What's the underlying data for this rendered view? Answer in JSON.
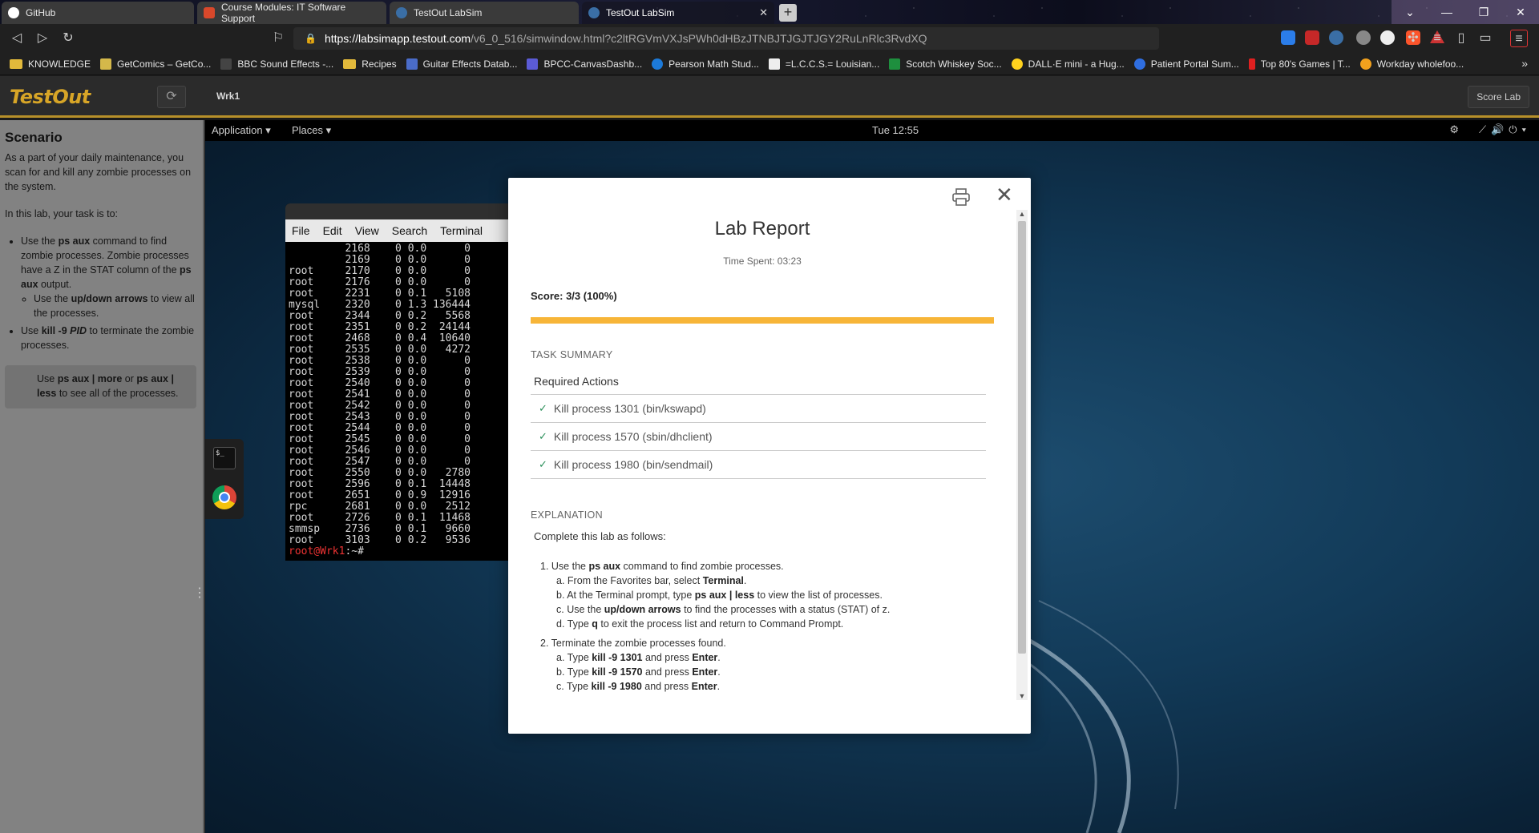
{
  "browser": {
    "tabs": [
      {
        "label": "GitHub",
        "favicon_color": "#ffffff"
      },
      {
        "label": "Course Modules: IT Software Support",
        "favicon_color": "#d9482b"
      },
      {
        "label": "TestOut LabSim",
        "favicon_color": "#3a6ea5"
      },
      {
        "label": "TestOut LabSim",
        "favicon_color": "#3a6ea5"
      }
    ],
    "active_tab_index": 3,
    "url_host": "https://labsimapp.testout.com",
    "url_rest": "/v6_0_516/simwindow.html?c2ltRGVmVXJsPWh0dHBzJTNBJTJGJTJGY2RuLnRlc3RvdXQuY29tJTJGX3ZlcnNpb25fNzAyOCUyRnB...",
    "bookmarks": [
      {
        "label": "KNOWLEDGE",
        "icon": "folder",
        "color": "#e2b93b"
      },
      {
        "label": "GetComics – GetCo...",
        "icon": "getcomics-icon",
        "color": "#d4b84a"
      },
      {
        "label": "BBC Sound Effects -...",
        "icon": "bbc-icon",
        "color": "#ffffff"
      },
      {
        "label": "Recipes",
        "icon": "folder",
        "color": "#e2b93b"
      },
      {
        "label": "Guitar Effects Datab...",
        "icon": "guitar-icon",
        "color": "#4a6cc9"
      },
      {
        "label": "BPCC-CanvasDashb...",
        "icon": "canvas-icon",
        "color": "#5b5bd6"
      },
      {
        "label": "Pearson Math Stud...",
        "icon": "pearson-icon",
        "color": "#1c7ad9"
      },
      {
        "label": "=L.C.C.S.= Louisian...",
        "icon": "lccs-icon",
        "color": "#eeeeee"
      },
      {
        "label": "Scotch Whiskey Soc...",
        "icon": "whiskey-icon",
        "color": "#1e8f3e"
      },
      {
        "label": "DALL·E mini - a Hug...",
        "icon": "huggingface-icon",
        "color": "#ffd21e"
      },
      {
        "label": "Patient Portal Sum...",
        "icon": "portal-icon",
        "color": "#2f6ee0"
      },
      {
        "label": "Top 80's Games | T...",
        "icon": "games-icon",
        "color": "#e02020"
      },
      {
        "label": "Workday wholefoo...",
        "icon": "workday-icon",
        "color": "#f2a11d"
      }
    ],
    "bookmarks_more": "»"
  },
  "testout": {
    "logo": "TestOut",
    "workstation": "Wrk1",
    "score_button": "Score Lab",
    "accent": "#d7a527"
  },
  "scenario": {
    "title": "Scenario",
    "intro": "As a part of your daily maintenance, you scan for and kill any zombie processes on the system.",
    "task_intro": "In this lab, your task is to:",
    "item1_a": "Use the ",
    "item1_cmd": "ps aux",
    "item1_b": " command to find zombie processes. Zombie processes have a Z in the STAT column of the ",
    "item1_cmd2": "ps aux",
    "item1_c": " output.",
    "subitem_a": "Use the ",
    "subitem_keys": "up/down arrows",
    "subitem_b": " to view all the processes.",
    "item2_a": "Use ",
    "item2_cmd": "kill -9",
    "item2_pid": "PID",
    "item2_b": " to terminate the zombie processes.",
    "hint_a": "Use ",
    "hint_cmd1": "ps aux | more",
    "hint_or": " or ",
    "hint_cmd2": "ps aux | less",
    "hint_b": " to see all of the processes."
  },
  "desktop": {
    "menu_application": "Application ▾",
    "menu_places": "Places ▾",
    "clock": "Tue 12:55",
    "terminal_menu": [
      "File",
      "Edit",
      "View",
      "Search",
      "Terminal"
    ],
    "terminal_rows": [
      [
        "",
        "2168",
        "0",
        "0.0",
        "0"
      ],
      [
        "",
        "2169",
        "0",
        "0.0",
        "0"
      ],
      [
        "root",
        "2170",
        "0",
        "0.0",
        "0"
      ],
      [
        "root",
        "2176",
        "0",
        "0.0",
        "0"
      ],
      [
        "root",
        "2231",
        "0",
        "0.1",
        "5108"
      ],
      [
        "mysql",
        "2320",
        "0",
        "1.3",
        "136444"
      ],
      [
        "root",
        "2344",
        "0",
        "0.2",
        "5568"
      ],
      [
        "root",
        "2351",
        "0",
        "0.2",
        "24144"
      ],
      [
        "root",
        "2468",
        "0",
        "0.4",
        "10640"
      ],
      [
        "root",
        "2535",
        "0",
        "0.0",
        "4272"
      ],
      [
        "root",
        "2538",
        "0",
        "0.0",
        "0"
      ],
      [
        "root",
        "2539",
        "0",
        "0.0",
        "0"
      ],
      [
        "root",
        "2540",
        "0",
        "0.0",
        "0"
      ],
      [
        "root",
        "2541",
        "0",
        "0.0",
        "0"
      ],
      [
        "root",
        "2542",
        "0",
        "0.0",
        "0"
      ],
      [
        "root",
        "2543",
        "0",
        "0.0",
        "0"
      ],
      [
        "root",
        "2544",
        "0",
        "0.0",
        "0"
      ],
      [
        "root",
        "2545",
        "0",
        "0.0",
        "0"
      ],
      [
        "root",
        "2546",
        "0",
        "0.0",
        "0"
      ],
      [
        "root",
        "2547",
        "0",
        "0.0",
        "0"
      ],
      [
        "root",
        "2550",
        "0",
        "0.0",
        "2780"
      ],
      [
        "root",
        "2596",
        "0",
        "0.1",
        "14448"
      ],
      [
        "root",
        "2651",
        "0",
        "0.9",
        "12916"
      ],
      [
        "rpc",
        "2681",
        "0",
        "0.0",
        "2512"
      ],
      [
        "root",
        "2726",
        "0",
        "0.1",
        "11468"
      ],
      [
        "smmsp",
        "2736",
        "0",
        "0.1",
        "9660"
      ],
      [
        "root",
        "3103",
        "0",
        "0.2",
        "9536"
      ]
    ],
    "prompt_user": "root@Wrk1",
    "prompt_rest": ":~#"
  },
  "report": {
    "title": "Lab Report",
    "time_spent": "Time Spent: 03:23",
    "score_label": "Score: 3/3 (100%)",
    "score_fraction": 1.0,
    "score_color": "#f7b538",
    "task_summary_heading": "TASK SUMMARY",
    "required_actions_heading": "Required Actions",
    "tasks": [
      "Kill process 1301 (bin/kswapd)",
      "Kill process 1570 (sbin/dhclient)",
      "Kill process 1980 (bin/sendmail)"
    ],
    "explanation_heading": "EXPLANATION",
    "explanation_intro": "Complete this lab as follows:",
    "s1": {
      "a": "1. Use the ",
      "b": "ps aux",
      "c": " command to find zombie processes."
    },
    "s1a": {
      "a": "a. From the Favorites bar, select ",
      "b": "Terminal",
      "c": "."
    },
    "s1b": {
      "a": "b. At the Terminal prompt, type ",
      "b": "ps aux | less",
      "c": " to view the list of processes."
    },
    "s1c": {
      "a": "c. Use the ",
      "b": "up/down arrows",
      "c": " to find the processes with a status (STAT) of z."
    },
    "s1d": {
      "a": "d. Type ",
      "b": "q",
      "c": " to exit the process list and return to Command Prompt."
    },
    "s2": "2. Terminate the zombie processes found.",
    "s2a": {
      "a": "a. Type ",
      "b": "kill -9 1301",
      "c": " and press ",
      "d": "Enter",
      "e": "."
    },
    "s2b": {
      "a": "b. Type ",
      "b": "kill -9 1570",
      "c": " and press ",
      "d": "Enter",
      "e": "."
    },
    "s2c": {
      "a": "c. Type ",
      "b": "kill -9 1980",
      "c": " and press ",
      "d": "Enter",
      "e": "."
    }
  }
}
